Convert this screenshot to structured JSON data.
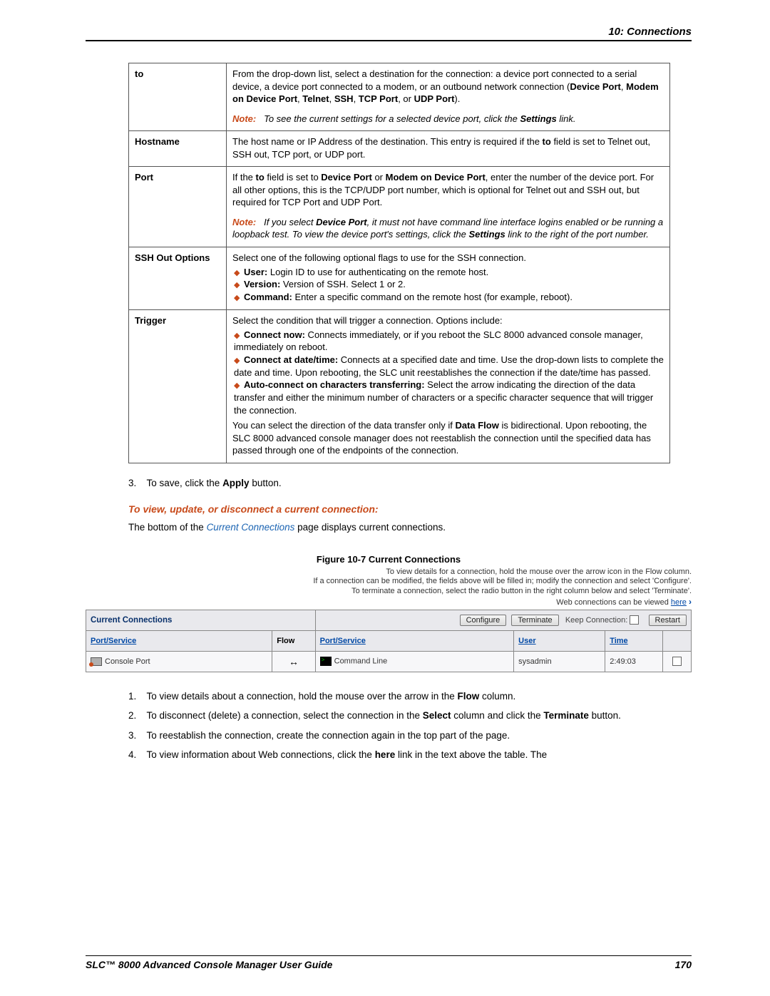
{
  "header": {
    "chapter": "10: Connections"
  },
  "table_rows": [
    {
      "term": "to",
      "para1_a": "From the drop-down list, select a destination for the connection: a device port connected to a serial device, a device port connected to a modem, or an outbound network connection (",
      "para1_b": "Device Port",
      "para1_c": ", ",
      "para1_d": "Modem on Device Port",
      "para1_e": ", ",
      "para1_f": "Telnet",
      "para1_g": ", ",
      "para1_h": "SSH",
      "para1_i": ", ",
      "para1_j": "TCP Port",
      "para1_k": ", or ",
      "para1_l": "UDP Port",
      "para1_m": ").",
      "note_label": "Note:",
      "note_a": "To see the current settings for a selected device port, click the ",
      "note_b": "Settings",
      "note_c": " link."
    },
    {
      "term": "Hostname",
      "para1_a": "The host name or IP Address of the destination. This entry is required if the ",
      "para1_b": "to",
      "para1_c": " field is set to Telnet out, SSH out, TCP port, or UDP port."
    },
    {
      "term": "Port",
      "para1_a": "If the ",
      "para1_b": "to",
      "para1_c": " field is set to ",
      "para1_d": "Device Port",
      "para1_e": " or ",
      "para1_f": "Modem on Device Port",
      "para1_g": ", enter the number of the device port. For all other options, this is the TCP/UDP port number, which is optional for Telnet out and SSH out, but required for TCP Port and UDP Port.",
      "note_label": "Note:",
      "note_a": "If you select ",
      "note_b": "Device Port",
      "note_c": ", it must not have command line interface logins enabled or be running a loopback test. To view the device port's settings, click the ",
      "note_d": "Settings",
      "note_e": " link to the right of the port number."
    },
    {
      "term": "SSH Out Options",
      "lead": "Select one of the following optional flags to use for the SSH connection.",
      "b1_a": "User:",
      "b1_b": " Login ID to use for authenticating on the remote host.",
      "b2_a": "Version:",
      "b2_b": " Version of SSH. Select 1 or 2.",
      "b3_a": "Command:",
      "b3_b": " Enter a specific command on the remote host (for example, reboot)."
    },
    {
      "term": "Trigger",
      "lead": "Select the condition that will trigger a connection. Options include:",
      "b1_a": "Connect now:",
      "b1_b": " Connects immediately, or if you reboot the SLC 8000 advanced console manager, immediately on reboot.",
      "b2_a": "Connect at date/time:",
      "b2_b": " Connects at a specified date and time. Use the drop-down lists to complete the date and time. Upon rebooting, the SLC unit reestablishes the connection if the date/time has passed.",
      "b3_a": "Auto-connect on characters transferring:",
      "b3_b": " Select the arrow indicating the direction of the data transfer and either the minimum number of characters or a specific character sequence that will trigger the connection.",
      "tail_a": "You can select the direction of the data transfer only if ",
      "tail_b": "Data Flow",
      "tail_c": " is bidirectional. Upon rebooting, the SLC 8000 advanced console manager does not reestablish the connection until the specified data has passed through one of the endpoints of the connection."
    }
  ],
  "step3_a": "To save, click the ",
  "step3_b": "Apply",
  "step3_c": " button.",
  "subhead": "To view, update, or disconnect a current connection:",
  "intro_a": "The bottom of the ",
  "intro_b": "Current Connections",
  "intro_c": " page displays current connections.",
  "fig": {
    "caption": "Figure 10-7  Current Connections",
    "line1": "To view details for a connection, hold the mouse over the arrow icon in the Flow column.",
    "line2": "If a connection can be modified, the fields above will be filled in; modify the connection and select 'Configure'.",
    "line3": "To terminate a connection, select the radio button in the right column below and select 'Terminate'.",
    "line4_a": "Web connections can be viewed ",
    "line4_b": "here",
    "title": "Current Connections",
    "btn_configure": "Configure",
    "btn_terminate": "Terminate",
    "keep_label": "Keep Connection:",
    "btn_restart": "Restart",
    "cols": {
      "ps1": "Port/Service",
      "flow": "Flow",
      "ps2": "Port/Service",
      "user": "User",
      "time": "Time"
    },
    "row": {
      "ps1": "Console Port",
      "ps2": "Command Line",
      "user": "sysadmin",
      "time": "2:49:03"
    }
  },
  "steps_after": {
    "s1_a": "To view details about a connection, hold the mouse over the arrow in the ",
    "s1_b": "Flow",
    "s1_c": " column.",
    "s2_a": "To disconnect (delete) a connection, select the connection in the ",
    "s2_b": "Select",
    "s2_c": " column and click the ",
    "s2_d": "Terminate",
    "s2_e": " button.",
    "s3": "To reestablish the connection, create the connection again in the top part of the page.",
    "s4_a": "To view information about Web connections, click the ",
    "s4_b": "here",
    "s4_c": " link in the text above the table. The"
  },
  "footer": {
    "left": "SLC™ 8000 Advanced Console Manager User Guide",
    "right": "170"
  }
}
